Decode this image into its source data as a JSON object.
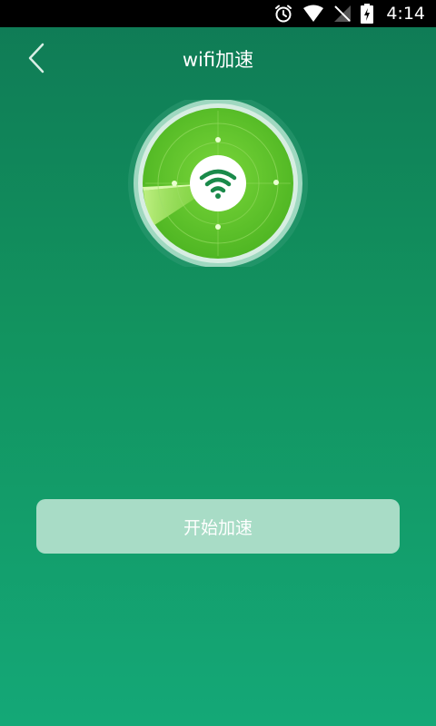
{
  "status_bar": {
    "time": "4:14",
    "icons": [
      "alarm-icon",
      "wifi-signal-icon",
      "cellular-signal-icon",
      "battery-charging-icon"
    ]
  },
  "app_bar": {
    "title": "wifi加速",
    "back_icon": "chevron-left-icon"
  },
  "scanner": {
    "center_icon": "wifi-icon",
    "accent_color": "#5ec32a"
  },
  "actions": {
    "start_label": "开始加速"
  },
  "colors": {
    "background_top": "#0f7a55",
    "background_bottom": "#14a877",
    "button_fill": "#a8dcc6"
  }
}
